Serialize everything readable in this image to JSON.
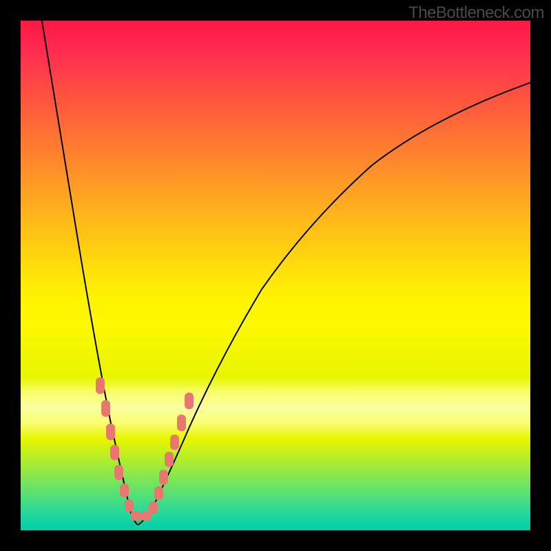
{
  "watermark": "TheBottleneck.com",
  "chart_data": {
    "type": "line",
    "title": "",
    "xlabel": "",
    "ylabel": "",
    "xlim": [
      0,
      100
    ],
    "ylim": [
      0,
      100
    ],
    "curve": {
      "description": "V-shaped bottleneck curve with minimum around x=22",
      "minimum_x": 22,
      "left_branch": [
        {
          "x": 4,
          "y": 100
        },
        {
          "x": 8,
          "y": 75
        },
        {
          "x": 12,
          "y": 50
        },
        {
          "x": 15,
          "y": 32
        },
        {
          "x": 18,
          "y": 18
        },
        {
          "x": 20,
          "y": 8
        },
        {
          "x": 22,
          "y": 2
        }
      ],
      "right_branch": [
        {
          "x": 22,
          "y": 2
        },
        {
          "x": 25,
          "y": 7
        },
        {
          "x": 30,
          "y": 18
        },
        {
          "x": 38,
          "y": 35
        },
        {
          "x": 48,
          "y": 52
        },
        {
          "x": 60,
          "y": 66
        },
        {
          "x": 72,
          "y": 76
        },
        {
          "x": 85,
          "y": 83
        },
        {
          "x": 100,
          "y": 88
        }
      ]
    },
    "data_points": [
      {
        "x": 15.5,
        "y": 28
      },
      {
        "x": 16.5,
        "y": 23
      },
      {
        "x": 17.5,
        "y": 18
      },
      {
        "x": 18.2,
        "y": 14
      },
      {
        "x": 19,
        "y": 10.5
      },
      {
        "x": 20,
        "y": 7
      },
      {
        "x": 21,
        "y": 4.5
      },
      {
        "x": 22.5,
        "y": 2.5
      },
      {
        "x": 24,
        "y": 2.5
      },
      {
        "x": 25,
        "y": 4.5
      },
      {
        "x": 26,
        "y": 7
      },
      {
        "x": 27,
        "y": 10
      },
      {
        "x": 28,
        "y": 13
      },
      {
        "x": 29,
        "y": 16
      },
      {
        "x": 30.5,
        "y": 20
      },
      {
        "x": 32,
        "y": 24
      }
    ],
    "gradient_colors": {
      "top": "#ff1744",
      "middle_upper": "#ff9228",
      "middle": "#fff400",
      "middle_lower": "#c0f020",
      "bottom": "#00d0a8",
      "light_band": "#fbfe9f"
    }
  }
}
